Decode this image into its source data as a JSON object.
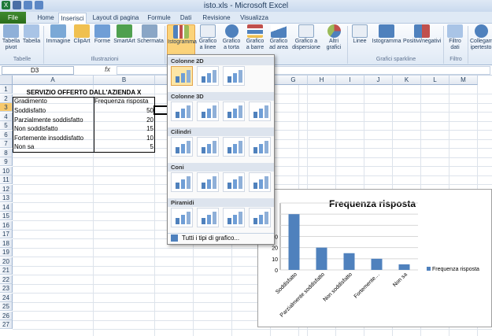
{
  "window_title": "isto.xls - Microsoft Excel",
  "tabs": [
    "File",
    "Home",
    "Inserisci",
    "Layout di pagina",
    "Formule",
    "Dati",
    "Revisione",
    "Visualizza"
  ],
  "ribbon": {
    "buttons": [
      "Tabella pivot",
      "Tabella",
      "Immagine",
      "ClipArt",
      "Forme",
      "SmartArt",
      "Schermata",
      "Istogramma",
      "Grafico a linee",
      "Grafico a torta",
      "Grafico a barre",
      "Grafico ad area",
      "Grafico a dispersione",
      "Altri grafici",
      "Linee",
      "Istogramma",
      "Positivi/negativi",
      "Filtro dati",
      "Collegamento ipertesto"
    ],
    "groups": [
      "Tabelle",
      "Illustrazioni",
      "Grafici sparkline",
      "Filtro"
    ]
  },
  "formula_bar": {
    "cell": "D3",
    "fx": "fx",
    "value": ""
  },
  "columns": [
    "A",
    "B",
    "C",
    "D",
    "E",
    "F",
    "G",
    "H",
    "I",
    "J",
    "K",
    "L",
    "M"
  ],
  "rows": [
    "1",
    "2",
    "3",
    "4",
    "5",
    "6",
    "7",
    "8",
    "9",
    "10",
    "11",
    "12",
    "13",
    "14",
    "15",
    "16",
    "17",
    "18",
    "19",
    "20",
    "21",
    "22",
    "23",
    "24",
    "25",
    "26",
    "27"
  ],
  "sheet": {
    "title": "SERVIZIO OFFERTO DALL'AZIENDA X",
    "header": [
      "Gradimento",
      "Frequenza risposta"
    ],
    "data": [
      [
        "Soddisfatto",
        "50"
      ],
      [
        "Parzialmente soddisfatto",
        "20"
      ],
      [
        "Non soddisfatto",
        "15"
      ],
      [
        "Fortemente insoddisfatto",
        "10"
      ],
      [
        "Non sa",
        "5"
      ]
    ]
  },
  "dropdown": {
    "sections": [
      "Colonne 2D",
      "Colonne 3D",
      "Cilindri",
      "Coni",
      "Piramidi"
    ],
    "all_types": "Tutti i tipi di grafico..."
  },
  "chart_data": {
    "type": "bar",
    "title": "Frequenza risposta",
    "categories": [
      "Soddisfatto",
      "Parzialmente soddisfatto",
      "Non soddisfatto",
      "Fortemente…",
      "Non sa"
    ],
    "series": [
      {
        "name": "Frequenza risposta",
        "values": [
          50,
          20,
          15,
          10,
          5
        ]
      }
    ],
    "ytick_labels": [
      "0",
      "10",
      "20",
      "30"
    ],
    "ylim": [
      0,
      60
    ],
    "legend": "right",
    "color": "#4f81bd"
  },
  "colors": {
    "accent": "#f8c96c",
    "file_tab": "#2b6d1d",
    "bar": "#4f81bd"
  }
}
